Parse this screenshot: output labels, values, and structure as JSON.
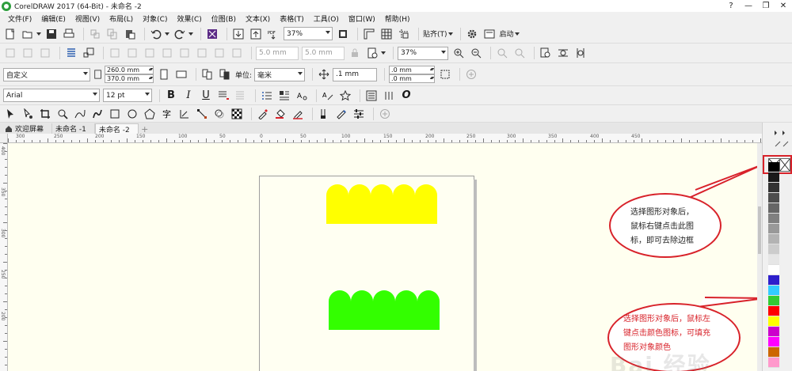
{
  "titlebar": {
    "title": "CorelDRAW 2017 (64-Bit) - 未命名 -2",
    "controls": {
      "help": "?",
      "minimize": "—",
      "restore": "❐",
      "close": "✕"
    }
  },
  "menu": [
    "文件(F)",
    "编辑(E)",
    "视图(V)",
    "布局(L)",
    "对象(C)",
    "效果(C)",
    "位图(B)",
    "文本(X)",
    "表格(T)",
    "工具(O)",
    "窗口(W)",
    "帮助(H)"
  ],
  "standard_toolbar": {
    "zoom": "37%",
    "snap_label": "贴齐(T)",
    "launch_label": "启动"
  },
  "property_bar_disabled": {
    "nudge_1": "5.0 mm",
    "nudge_2": "5.0 mm",
    "zoom": "37%"
  },
  "property_bar": {
    "page_preset": "自定义",
    "width": "260.0 mm",
    "height": "370.0 mm",
    "units_label": "单位:",
    "units": "毫米",
    "nudge": ".1 mm",
    "dup_x": ".0 mm",
    "dup_y": ".0 mm"
  },
  "text_bar": {
    "font": "Arial",
    "size": "12 pt",
    "bold": "B",
    "italic": "I",
    "underline": "U",
    "text_style": "O"
  },
  "doc_tabs": [
    "欢迎屏幕",
    "未命名 -1",
    "未命名 -2"
  ],
  "ruler_top_labels": [
    "300",
    "250",
    "200",
    "150",
    "100",
    "50",
    "0",
    "50",
    "100",
    "150",
    "200",
    "250",
    "300",
    "350",
    "400",
    "450"
  ],
  "ruler_left_labels": [
    "400",
    "350",
    "300",
    "250",
    "200"
  ],
  "shapes": [
    {
      "name": "yellow-scallop-shape",
      "fill": "#ffff00"
    },
    {
      "name": "green-scallop-shape",
      "fill": "#33ff00"
    }
  ],
  "callouts": {
    "no_color_tip": [
      "选择图形对象后，",
      "鼠标右键点击此图",
      "标，即可去除边框"
    ],
    "fill_color_tip": [
      "选择图形对象后，鼠标左",
      "键点击颜色图标，可填充",
      "图形对象颜色"
    ]
  },
  "palette": [
    "#000000",
    "#1a1a1a",
    "#333333",
    "#4d4d4d",
    "#666666",
    "#808080",
    "#999999",
    "#b3b3b3",
    "#cccccc",
    "#e6e6e6",
    "#ffffff",
    "#2e1fcc",
    "#33ccff",
    "#33cc33",
    "#ff0000",
    "#ffff00",
    "#cc00cc",
    "#ff00ff",
    "#cc6600",
    "#ff99cc"
  ],
  "colors": {
    "callout_border": "#d8222a",
    "canvas_bg": "#fffff0"
  },
  "watermark": "Bai 经验"
}
